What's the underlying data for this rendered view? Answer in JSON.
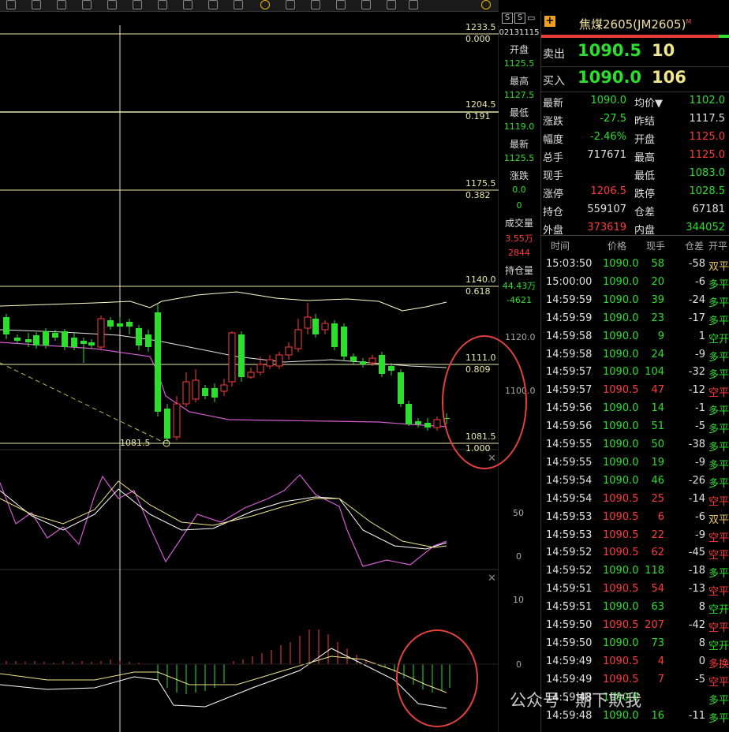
{
  "colors": {
    "up": "#ff3b3b",
    "down": "#2ede2e",
    "fib": "#e8e8a8",
    "accent": "#ff9900"
  },
  "fib_levels": [
    {
      "price": "1233.5",
      "ratio": "0.000"
    },
    {
      "price": "1204.5",
      "ratio": "0.191"
    },
    {
      "price": "1175.5",
      "ratio": "0.382"
    },
    {
      "price": "1140.0",
      "ratio": "0.618"
    },
    {
      "price": "1111.0",
      "ratio": "0.809"
    },
    {
      "price": "1081.5",
      "ratio": "1.000"
    }
  ],
  "low_marker": "1081.5",
  "price_axis": [
    "1120.0",
    "1100.0"
  ],
  "kdj_axis": [
    "50",
    "0"
  ],
  "macd_axis": [
    "10",
    "0"
  ],
  "mid_info": {
    "time": "02131115",
    "open_label": "开盘",
    "open": "1125.5",
    "high_label": "最高",
    "high": "1127.5",
    "low_label": "最低",
    "low": "1119.0",
    "last_label": "最新",
    "last": "1125.5",
    "chg_label": "涨跌",
    "chg": "0.0",
    "chg2": "0",
    "vol_label": "成交量",
    "vol": "3.55万",
    "vol2": "2844",
    "oi_label": "持仓量",
    "oi": "44.43万",
    "oi2": "-4621"
  },
  "quote": {
    "title": "焦煤2605(JM2605)",
    "title_sup": "M",
    "ask_label": "卖出",
    "ask_price": "1090.5",
    "ask_qty": "10",
    "bid_label": "买入",
    "bid_price": "1090.0",
    "bid_qty": "106",
    "stats": [
      [
        {
          "l": "最新",
          "v": "1090.0",
          "c": "green"
        },
        {
          "l": "均价▼",
          "v": "1102.0",
          "c": "green"
        }
      ],
      [
        {
          "l": "涨跌",
          "v": "-27.5",
          "c": "green"
        },
        {
          "l": "昨结",
          "v": "1117.5",
          "c": "white"
        }
      ],
      [
        {
          "l": "幅度",
          "v": "-2.46%",
          "c": "green"
        },
        {
          "l": "开盘",
          "v": "1125.0",
          "c": "red"
        }
      ],
      [
        {
          "l": "总手",
          "v": "717671",
          "c": "white"
        },
        {
          "l": "最高",
          "v": "1125.0",
          "c": "red"
        }
      ],
      [
        {
          "l": "现手",
          "v": "",
          "c": "white"
        },
        {
          "l": "最低",
          "v": "1083.0",
          "c": "green"
        }
      ],
      [
        {
          "l": "涨停",
          "v": "1206.5",
          "c": "red"
        },
        {
          "l": "跌停",
          "v": "1028.5",
          "c": "green"
        }
      ],
      [
        {
          "l": "持仓",
          "v": "559107",
          "c": "white"
        },
        {
          "l": "仓差",
          "v": "67181",
          "c": "white"
        }
      ],
      [
        {
          "l": "外盘",
          "v": "373619",
          "c": "red"
        },
        {
          "l": "内盘",
          "v": "344052",
          "c": "green"
        }
      ]
    ],
    "tick_headers": [
      "时间",
      "价格",
      "现手",
      "仓差",
      "开平"
    ],
    "ticks": [
      [
        "15:03:50",
        "1090.0",
        "58",
        "-58",
        "双平",
        "green",
        "green",
        "gold"
      ],
      [
        "15:00:00",
        "1090.0",
        "20",
        "-6",
        "多平",
        "green",
        "green",
        "green"
      ],
      [
        "14:59:59",
        "1090.0",
        "39",
        "-24",
        "多平",
        "green",
        "green",
        "green"
      ],
      [
        "14:59:59",
        "1090.0",
        "23",
        "-17",
        "多平",
        "green",
        "green",
        "green"
      ],
      [
        "14:59:58",
        "1090.0",
        "9",
        "1",
        "空开",
        "green",
        "green",
        "green"
      ],
      [
        "14:59:58",
        "1090.0",
        "24",
        "-9",
        "多平",
        "green",
        "green",
        "green"
      ],
      [
        "14:59:57",
        "1090.0",
        "104",
        "-32",
        "多平",
        "green",
        "green",
        "green"
      ],
      [
        "14:59:57",
        "1090.5",
        "47",
        "-12",
        "空平",
        "red",
        "red",
        "red"
      ],
      [
        "14:59:56",
        "1090.0",
        "14",
        "-1",
        "多平",
        "green",
        "green",
        "green"
      ],
      [
        "14:59:56",
        "1090.0",
        "51",
        "-5",
        "多平",
        "green",
        "green",
        "green"
      ],
      [
        "14:59:55",
        "1090.0",
        "50",
        "-38",
        "多平",
        "green",
        "green",
        "green"
      ],
      [
        "14:59:55",
        "1090.0",
        "19",
        "-9",
        "多平",
        "green",
        "green",
        "green"
      ],
      [
        "14:59:54",
        "1090.0",
        "46",
        "-26",
        "多平",
        "green",
        "green",
        "green"
      ],
      [
        "14:59:54",
        "1090.5",
        "25",
        "-14",
        "空平",
        "red",
        "red",
        "red"
      ],
      [
        "14:59:53",
        "1090.5",
        "6",
        "-6",
        "双平",
        "red",
        "red",
        "gold"
      ],
      [
        "14:59:53",
        "1090.5",
        "22",
        "-9",
        "空平",
        "red",
        "red",
        "red"
      ],
      [
        "14:59:52",
        "1090.5",
        "62",
        "-45",
        "空平",
        "red",
        "red",
        "red"
      ],
      [
        "14:59:52",
        "1090.0",
        "118",
        "-18",
        "多平",
        "green",
        "green",
        "green"
      ],
      [
        "14:59:51",
        "1090.5",
        "54",
        "-13",
        "空平",
        "red",
        "red",
        "red"
      ],
      [
        "14:59:51",
        "1090.0",
        "63",
        "8",
        "空开",
        "green",
        "green",
        "green"
      ],
      [
        "14:59:50",
        "1090.5",
        "207",
        "-42",
        "空平",
        "red",
        "red",
        "red"
      ],
      [
        "14:59:50",
        "1090.0",
        "73",
        "8",
        "空开",
        "green",
        "green",
        "green"
      ],
      [
        "14:59:49",
        "1090.5",
        "4",
        "0",
        "多换",
        "red",
        "red",
        "red"
      ],
      [
        "14:59:49",
        "1090.5",
        "7",
        "-5",
        "空平",
        "red",
        "red",
        "red"
      ],
      [
        "14:59:48",
        "1090.0",
        "",
        "",
        "多平",
        "green",
        "green",
        "green"
      ],
      [
        "14:59:48",
        "1090.0",
        "16",
        "-11",
        "多平",
        "green",
        "green",
        "green"
      ]
    ]
  },
  "watermark": "公众号 · 期下欺我"
}
